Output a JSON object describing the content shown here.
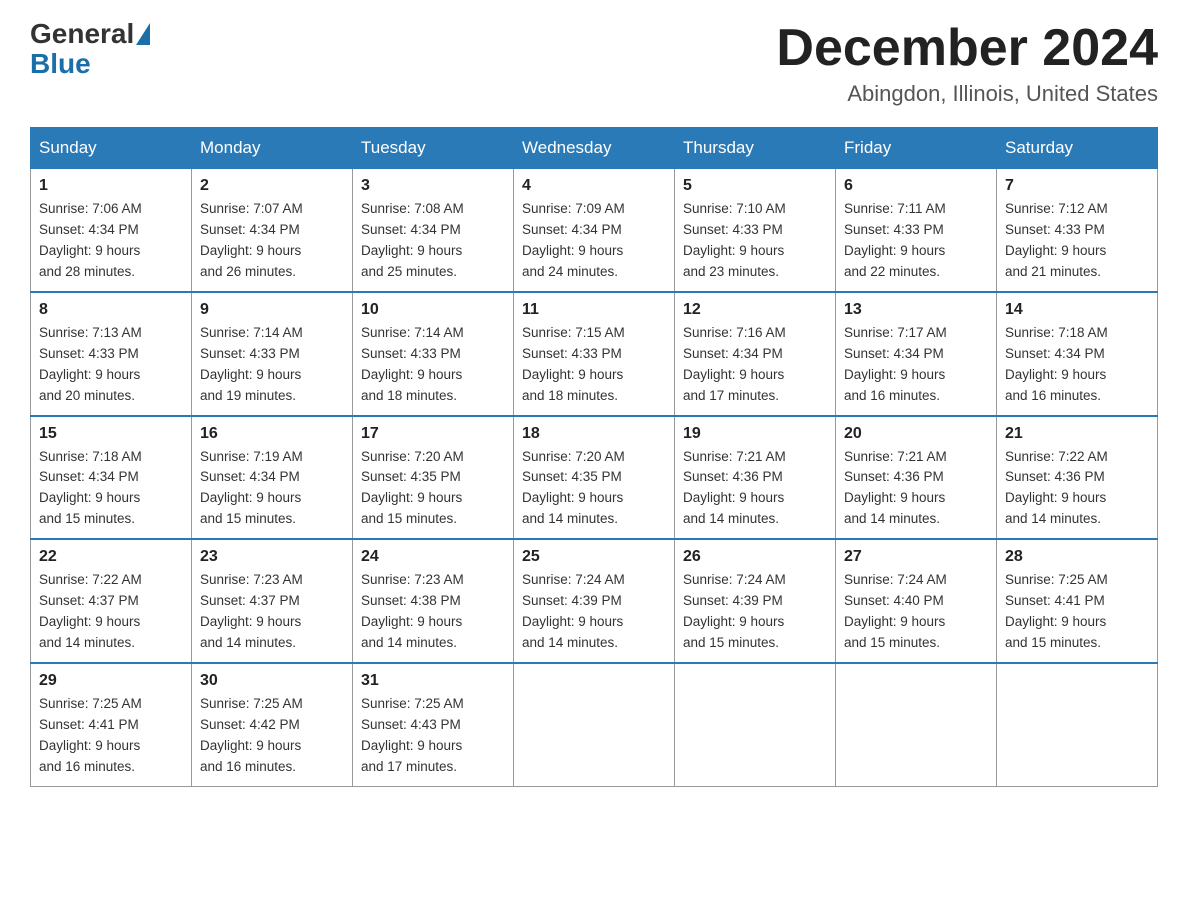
{
  "header": {
    "logo": {
      "general": "General",
      "blue": "Blue"
    },
    "title": "December 2024",
    "location": "Abingdon, Illinois, United States"
  },
  "days_of_week": [
    "Sunday",
    "Monday",
    "Tuesday",
    "Wednesday",
    "Thursday",
    "Friday",
    "Saturday"
  ],
  "weeks": [
    [
      {
        "day": "1",
        "sunrise": "7:06 AM",
        "sunset": "4:34 PM",
        "daylight": "9 hours and 28 minutes."
      },
      {
        "day": "2",
        "sunrise": "7:07 AM",
        "sunset": "4:34 PM",
        "daylight": "9 hours and 26 minutes."
      },
      {
        "day": "3",
        "sunrise": "7:08 AM",
        "sunset": "4:34 PM",
        "daylight": "9 hours and 25 minutes."
      },
      {
        "day": "4",
        "sunrise": "7:09 AM",
        "sunset": "4:34 PM",
        "daylight": "9 hours and 24 minutes."
      },
      {
        "day": "5",
        "sunrise": "7:10 AM",
        "sunset": "4:33 PM",
        "daylight": "9 hours and 23 minutes."
      },
      {
        "day": "6",
        "sunrise": "7:11 AM",
        "sunset": "4:33 PM",
        "daylight": "9 hours and 22 minutes."
      },
      {
        "day": "7",
        "sunrise": "7:12 AM",
        "sunset": "4:33 PM",
        "daylight": "9 hours and 21 minutes."
      }
    ],
    [
      {
        "day": "8",
        "sunrise": "7:13 AM",
        "sunset": "4:33 PM",
        "daylight": "9 hours and 20 minutes."
      },
      {
        "day": "9",
        "sunrise": "7:14 AM",
        "sunset": "4:33 PM",
        "daylight": "9 hours and 19 minutes."
      },
      {
        "day": "10",
        "sunrise": "7:14 AM",
        "sunset": "4:33 PM",
        "daylight": "9 hours and 18 minutes."
      },
      {
        "day": "11",
        "sunrise": "7:15 AM",
        "sunset": "4:33 PM",
        "daylight": "9 hours and 18 minutes."
      },
      {
        "day": "12",
        "sunrise": "7:16 AM",
        "sunset": "4:34 PM",
        "daylight": "9 hours and 17 minutes."
      },
      {
        "day": "13",
        "sunrise": "7:17 AM",
        "sunset": "4:34 PM",
        "daylight": "9 hours and 16 minutes."
      },
      {
        "day": "14",
        "sunrise": "7:18 AM",
        "sunset": "4:34 PM",
        "daylight": "9 hours and 16 minutes."
      }
    ],
    [
      {
        "day": "15",
        "sunrise": "7:18 AM",
        "sunset": "4:34 PM",
        "daylight": "9 hours and 15 minutes."
      },
      {
        "day": "16",
        "sunrise": "7:19 AM",
        "sunset": "4:34 PM",
        "daylight": "9 hours and 15 minutes."
      },
      {
        "day": "17",
        "sunrise": "7:20 AM",
        "sunset": "4:35 PM",
        "daylight": "9 hours and 15 minutes."
      },
      {
        "day": "18",
        "sunrise": "7:20 AM",
        "sunset": "4:35 PM",
        "daylight": "9 hours and 14 minutes."
      },
      {
        "day": "19",
        "sunrise": "7:21 AM",
        "sunset": "4:36 PM",
        "daylight": "9 hours and 14 minutes."
      },
      {
        "day": "20",
        "sunrise": "7:21 AM",
        "sunset": "4:36 PM",
        "daylight": "9 hours and 14 minutes."
      },
      {
        "day": "21",
        "sunrise": "7:22 AM",
        "sunset": "4:36 PM",
        "daylight": "9 hours and 14 minutes."
      }
    ],
    [
      {
        "day": "22",
        "sunrise": "7:22 AM",
        "sunset": "4:37 PM",
        "daylight": "9 hours and 14 minutes."
      },
      {
        "day": "23",
        "sunrise": "7:23 AM",
        "sunset": "4:37 PM",
        "daylight": "9 hours and 14 minutes."
      },
      {
        "day": "24",
        "sunrise": "7:23 AM",
        "sunset": "4:38 PM",
        "daylight": "9 hours and 14 minutes."
      },
      {
        "day": "25",
        "sunrise": "7:24 AM",
        "sunset": "4:39 PM",
        "daylight": "9 hours and 14 minutes."
      },
      {
        "day": "26",
        "sunrise": "7:24 AM",
        "sunset": "4:39 PM",
        "daylight": "9 hours and 15 minutes."
      },
      {
        "day": "27",
        "sunrise": "7:24 AM",
        "sunset": "4:40 PM",
        "daylight": "9 hours and 15 minutes."
      },
      {
        "day": "28",
        "sunrise": "7:25 AM",
        "sunset": "4:41 PM",
        "daylight": "9 hours and 15 minutes."
      }
    ],
    [
      {
        "day": "29",
        "sunrise": "7:25 AM",
        "sunset": "4:41 PM",
        "daylight": "9 hours and 16 minutes."
      },
      {
        "day": "30",
        "sunrise": "7:25 AM",
        "sunset": "4:42 PM",
        "daylight": "9 hours and 16 minutes."
      },
      {
        "day": "31",
        "sunrise": "7:25 AM",
        "sunset": "4:43 PM",
        "daylight": "9 hours and 17 minutes."
      },
      null,
      null,
      null,
      null
    ]
  ],
  "labels": {
    "sunrise": "Sunrise:",
    "sunset": "Sunset:",
    "daylight": "Daylight:"
  }
}
